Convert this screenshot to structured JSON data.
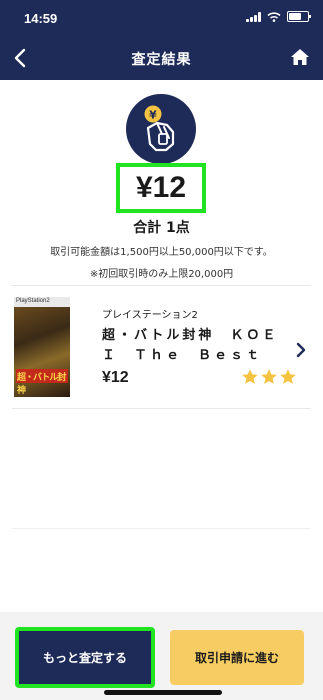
{
  "status_bar": {
    "time": "14:59"
  },
  "nav": {
    "title": "査定結果"
  },
  "summary": {
    "amount": "¥12",
    "total": "合計 1点",
    "note_range": "取引可能金額は1,500円以上50,000円以下です。",
    "note_first": "※初回取引時のみ上限20,000円"
  },
  "item": {
    "cover_brand": "PlayStation2",
    "cover_title": "超・バトル封神",
    "platform": "プレイステーション2",
    "title": "超・バトル封神　ＫＯＥＩ　Ｔｈｅ　Ｂｅｓｔ",
    "price": "¥12",
    "rating": 3,
    "star_color": "#f5c342"
  },
  "footer": {
    "more_label": "もっと査定する",
    "apply_label": "取引申請に進む"
  },
  "colors": {
    "navy": "#1e2a58",
    "highlight": "#21e321",
    "apply_button": "#f7cd63"
  }
}
